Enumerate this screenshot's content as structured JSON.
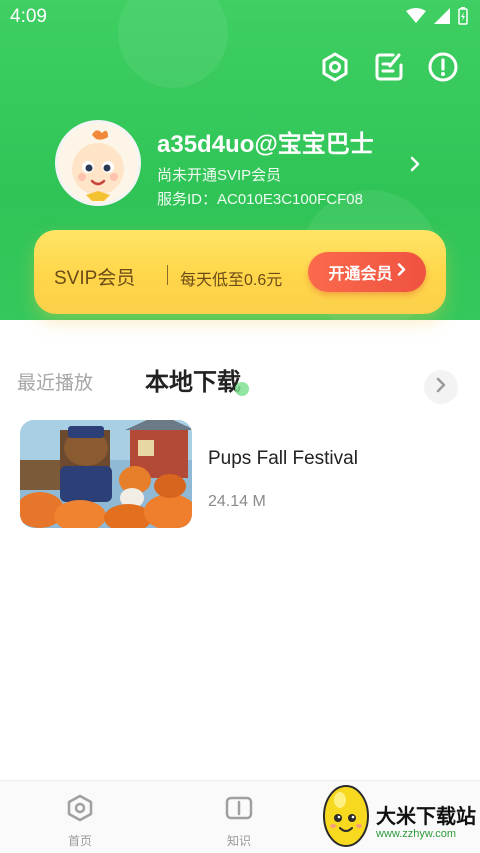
{
  "status_bar": {
    "time": "4:09"
  },
  "profile": {
    "username": "a35d4uo@宝宝巴士",
    "vip_status": "尚未开通SVIP会员",
    "service_id": "服务ID：AC010E3C100FCF08"
  },
  "svip_card": {
    "title": "SVIP会员",
    "description": "每天低至0.6元",
    "button_label": "开通会员"
  },
  "tabs": [
    {
      "label": "最近播放",
      "active": false
    },
    {
      "label": "本地下载",
      "active": true
    }
  ],
  "downloads": [
    {
      "title": "Pups Fall Festival",
      "size": "24.14 M"
    }
  ],
  "bottom_nav": [
    {
      "label": "首页",
      "icon": "home-icon"
    },
    {
      "label": "知识",
      "icon": "book-icon"
    }
  ],
  "watermark": {
    "title": "大米下载站",
    "url": "www.zzhyw.com"
  },
  "colors": {
    "header_green": "#35c85c",
    "svip_gold": "#ffd64a",
    "button_red": "#f35a44",
    "accent_green": "#7ee08f"
  },
  "icons": {
    "settings": "gear-icon",
    "edit": "edit-note-icon",
    "info": "exclamation-icon",
    "chevron": "chevron-right-icon"
  }
}
